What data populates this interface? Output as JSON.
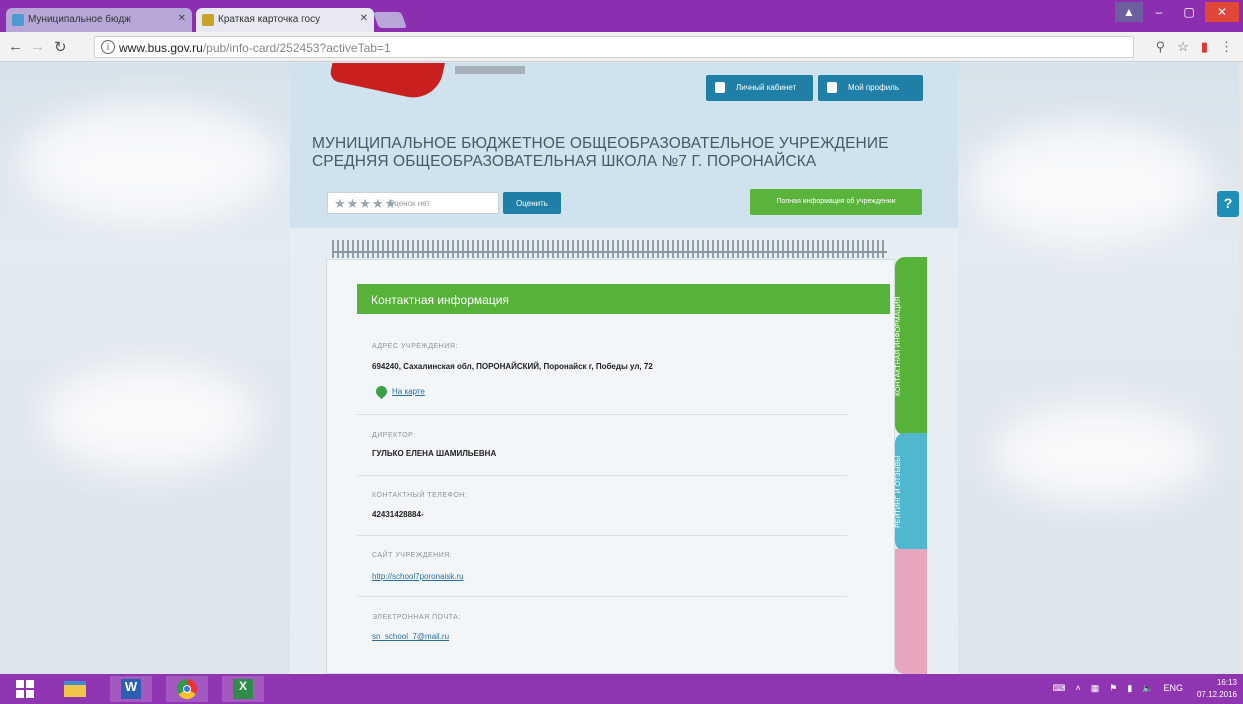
{
  "browser": {
    "tabs": [
      {
        "label": "Муниципальное бюдж",
        "active": false
      },
      {
        "label": "Краткая карточка госу",
        "active": true
      }
    ],
    "url_host": "www.bus.gov.ru",
    "url_path": "/pub/info-card/252453?activeTab=1"
  },
  "header": {
    "cabinet_label": "Личный кабинет",
    "profile_label": "Мой профиль",
    "org_title": "МУНИЦИПАЛЬНОЕ БЮДЖЕТНОЕ ОБЩЕОБРАЗОВАТЕЛЬНОЕ УЧРЕЖДЕНИЕ СРЕДНЯЯ ОБЩЕОБРАЗОВАТЕЛЬНАЯ ШКОЛА №7 Г. ПОРОНАЙСКА",
    "rating_placeholder": "Оценок нет",
    "rate_button": "Оценить",
    "full_info_button": "Полная информация об учреждении"
  },
  "card": {
    "title": "Контактная информация",
    "address_label": "АДРЕС УЧРЕЖДЕНИЯ:",
    "address_value": "694240, Сахалинская обл, ПОРОНАЙСКИЙ, Поронайск г, Победы ул, 72",
    "map_link": "На карте",
    "director_label": "ДИРЕКТОР:",
    "director_value": "ГУЛЬКО ЕЛЕНА ШАМИЛЬЕВНА",
    "phone_label": "КОНТАКТНЫЙ ТЕЛЕФОН:",
    "phone_value": "42431428884-",
    "site_label": "САЙТ УЧРЕЖДЕНИЯ:",
    "site_value": "http://school7poronaisk.ru",
    "email_label": "ЭЛЕКТРОННАЯ ПОЧТА:",
    "email_value": "sn_school_7@mail.ru"
  },
  "side_tabs": [
    {
      "label": "КОНТАКТНАЯ ИНФОРМАЦИЯ",
      "color": "#56b239"
    },
    {
      "label": "РЕЙТИНГ И ОТЗЫВЫ",
      "color": "#4fb8cf"
    },
    {
      "label": "",
      "color": "#e7a6bd"
    }
  ],
  "taskbar": {
    "lang": "ENG",
    "time": "16:13",
    "date": "07.12.2016"
  }
}
